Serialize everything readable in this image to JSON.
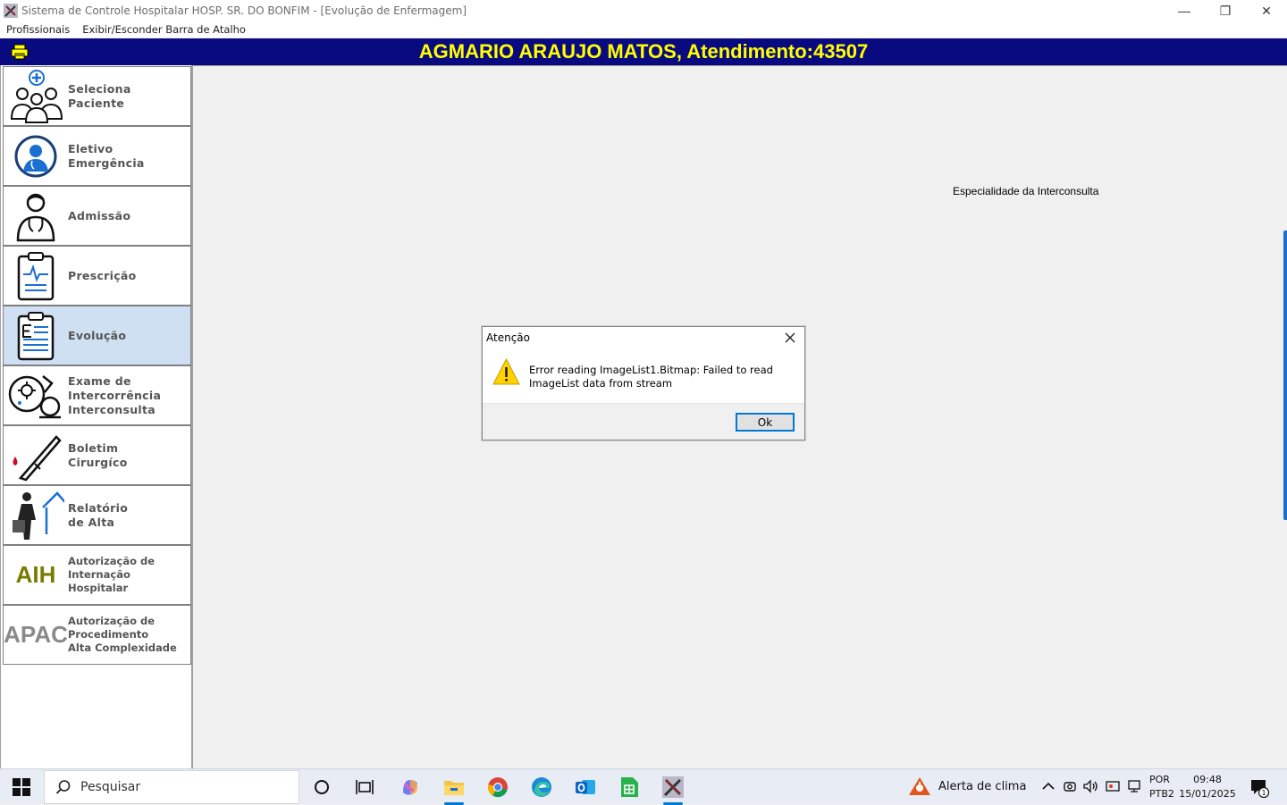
{
  "window": {
    "title": "Sistema de Controle Hospitalar HOSP. SR. DO BONFIM - [Evolução de Enfermagem]",
    "controls": {
      "minimize": "—",
      "restore": "❐",
      "close": "✕"
    }
  },
  "menubar": {
    "items": [
      "Profissionais",
      "Exibir/Esconder Barra de Atalho"
    ]
  },
  "header": {
    "patient_title": "AGMARIO ARAUJO MATOS, Atendimento:43507"
  },
  "sidebar": {
    "items": [
      {
        "lines": [
          "Seleciona",
          "Paciente"
        ],
        "icon": "doctors-group-icon"
      },
      {
        "lines": [
          "Eletivo",
          "Emergência"
        ],
        "icon": "doctor-avatar-icon"
      },
      {
        "lines": [
          "Admissão"
        ],
        "icon": "physician-icon"
      },
      {
        "lines": [
          "Prescrição"
        ],
        "icon": "clipboard-pulse-icon"
      },
      {
        "lines": [
          "Evolução"
        ],
        "icon": "clipboard-e-icon",
        "active": true
      },
      {
        "lines": [
          "Exame de",
          "Intercorrência",
          "Interconsulta"
        ],
        "icon": "microscope-icon"
      },
      {
        "lines": [
          "Boletim",
          "Cirurgíco"
        ],
        "icon": "scalpel-icon"
      },
      {
        "lines": [
          "Relatório",
          "de Alta"
        ],
        "icon": "discharge-icon"
      },
      {
        "lines": [
          "Autorização de",
          "Internação",
          "Hospitalar"
        ],
        "icon_text": "AIH"
      },
      {
        "lines": [
          "Autorização de",
          "Procedimento",
          "Alta Complexidade"
        ],
        "icon_text": "APAC"
      }
    ]
  },
  "main": {
    "interconsulta_label": "Especialidade da Interconsulta"
  },
  "dialog": {
    "title": "Atenção",
    "message_line1": "Error reading ImageList1.Bitmap: Failed to read",
    "message_line2": "ImageList data from stream",
    "ok_label": "Ok"
  },
  "taskbar": {
    "search_placeholder": "Pesquisar",
    "weather_label": "Alerta de clima",
    "lang_line1": "POR",
    "lang_line2": "PTB2",
    "time": "09:48",
    "date": "15/01/2025",
    "notification_count": "1"
  },
  "colors": {
    "header_bg": "#0a0a80",
    "header_text": "#ffff00",
    "active_item_bg": "#cfe0f3",
    "accent": "#0078d4"
  }
}
